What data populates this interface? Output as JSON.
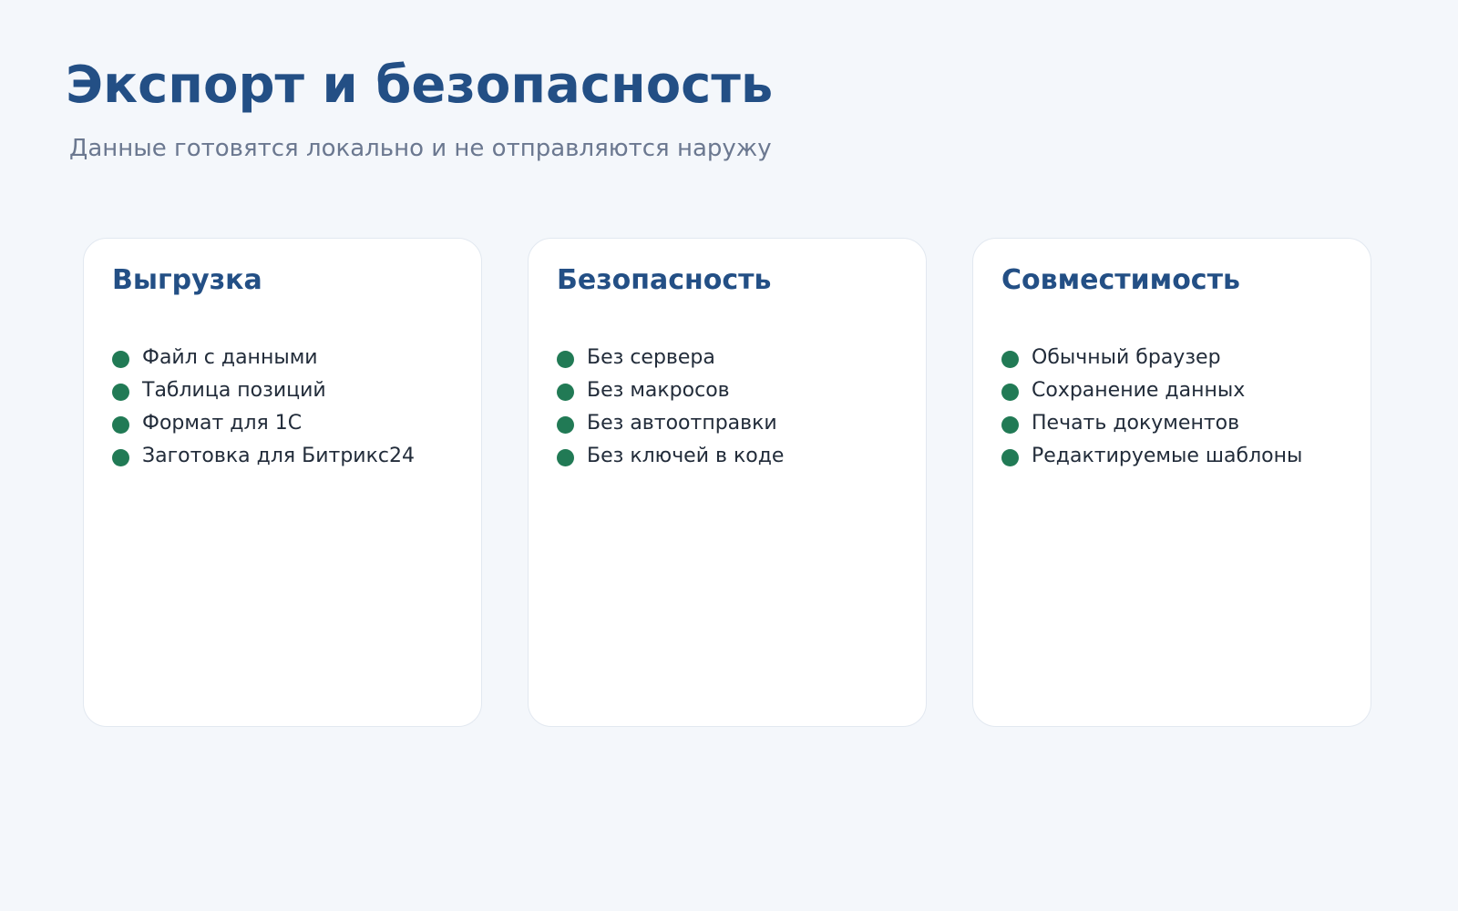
{
  "header": {
    "title": "Экспорт и безопасность",
    "subtitle": "Данные готовятся локально и не отправляются наружу"
  },
  "colors": {
    "bullet": "#217a55"
  },
  "cards": [
    {
      "title": "Выгрузка",
      "items": [
        "Файл с данными",
        "Таблица позиций",
        "Формат для 1С",
        "Заготовка для Битрикс24"
      ]
    },
    {
      "title": "Безопасность",
      "items": [
        "Без сервера",
        "Без макросов",
        "Без автоотправки",
        "Без ключей в коде"
      ]
    },
    {
      "title": "Совместимость",
      "items": [
        "Обычный браузер",
        "Сохранение данных",
        "Печать документов",
        "Редактируемые шаблоны"
      ]
    }
  ]
}
